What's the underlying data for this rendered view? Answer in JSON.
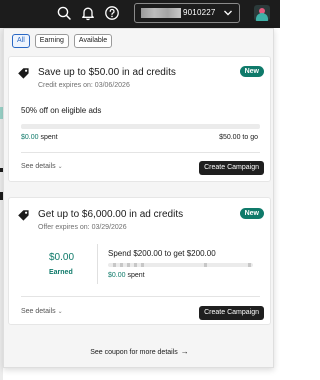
{
  "header": {
    "account_number": "9010227",
    "icons": [
      "search-icon",
      "bell-icon",
      "help-icon",
      "chevron-down-icon",
      "avatar"
    ]
  },
  "filters": {
    "chips": [
      {
        "label": "All",
        "active": true
      },
      {
        "label": "Earning",
        "active": false
      },
      {
        "label": "Available",
        "active": false
      }
    ]
  },
  "offers": [
    {
      "title": "Save up to $50.00 in ad credits",
      "expires": "Credit expires on: 03/06/2026",
      "badge": "New",
      "description": "50% off on eligible ads",
      "progress_fraction": 0.0,
      "spent": "$0.00",
      "spent_suffix": " spent",
      "to_go": "$50.00 to go",
      "see_details": "See details",
      "button": "Create Campaign"
    },
    {
      "title": "Get up to $6,000.00 in ad credits",
      "expires": "Offer expires on: 03/29/2026",
      "badge": "New",
      "earned_amount": "$0.00",
      "earned_label": "Earned",
      "spend_get": "Spend $200.00 to get $200.00",
      "progress_fraction": 0.0,
      "spent": "$0.00",
      "spent_suffix": " spent",
      "see_details": "See details",
      "button": "Create Campaign"
    }
  ],
  "footer": {
    "see_coupon": "See coupon for more details"
  },
  "colors": {
    "accent_teal": "#0f7a6a",
    "active_chip": "#2a68c4",
    "topbar": "#1c1c1c",
    "button": "#1f1f1f"
  }
}
